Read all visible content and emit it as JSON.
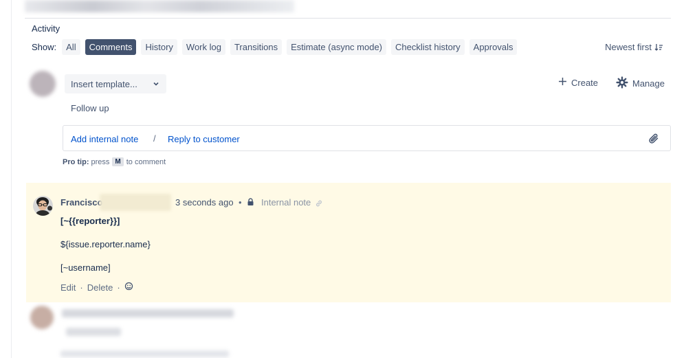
{
  "activity": {
    "title": "Activity",
    "show_label": "Show:",
    "filters": [
      {
        "label": "All",
        "active": false
      },
      {
        "label": "Comments",
        "active": true
      },
      {
        "label": "History",
        "active": false
      },
      {
        "label": "Work log",
        "active": false
      },
      {
        "label": "Transitions",
        "active": false
      },
      {
        "label": "Estimate (async mode)",
        "active": false
      },
      {
        "label": "Checklist history",
        "active": false
      },
      {
        "label": "Approvals",
        "active": false
      }
    ],
    "sort_label": "Newest first"
  },
  "composer": {
    "template_placeholder": "Insert template...",
    "create_label": "Create",
    "manage_label": "Manage",
    "follow_up": "Follow up",
    "add_internal_note": "Add internal note",
    "separator": "/",
    "reply_to_customer": "Reply to customer",
    "protip_label": "Pro tip:",
    "protip_press": "press",
    "protip_key": "M",
    "protip_suffix": "to comment"
  },
  "comment": {
    "author": "Francisco",
    "time": "3 seconds ago",
    "dot": "•",
    "visibility": "Internal note",
    "lines": [
      "[~{{reporter}}]",
      "${issue.reporter.name}",
      "[~username]"
    ],
    "actions": {
      "edit": "Edit",
      "dot": "·",
      "delete": "Delete"
    }
  },
  "colors": {
    "accent_link": "#0052cc",
    "active_filter_bg": "#42526e",
    "internal_note_bg": "#fffae6",
    "text_primary": "#172b4d",
    "text_secondary": "#42526e"
  },
  "icons": [
    "chevron-down-icon",
    "sort-icon",
    "plus-icon",
    "gear-icon",
    "paperclip-icon",
    "lock-icon",
    "link-icon",
    "add-reaction-icon",
    "avatar"
  ]
}
